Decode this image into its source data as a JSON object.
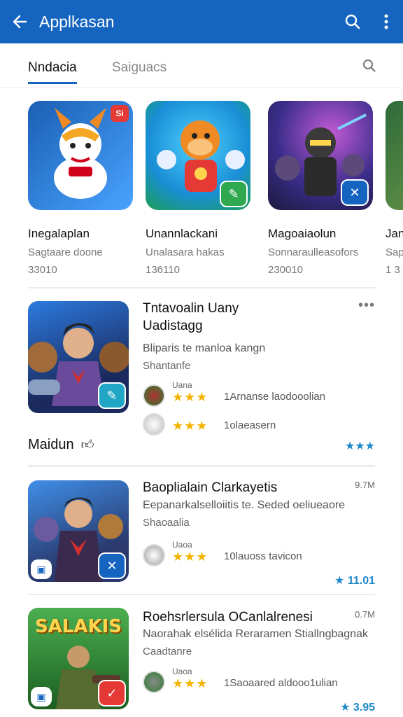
{
  "appbar": {
    "title": "Applkasan"
  },
  "tabs": [
    {
      "label": "Nndacia"
    },
    {
      "label": "Saiguacs"
    }
  ],
  "featured": [
    {
      "name": "Inegalaplan",
      "sub": "Sagtaare doone",
      "count": "33010",
      "badge": "Si",
      "colors": [
        "#1a5fb4",
        "#4aa3ff"
      ]
    },
    {
      "name": "Unannlackani",
      "sub": "Unalasara hakas",
      "count": "136110",
      "colors": [
        "#19a3d6",
        "#1fc87b"
      ]
    },
    {
      "name": "Magoaiaolun",
      "sub": "Sonnaraulleasofors",
      "count": "230010",
      "colors": [
        "#2a2b6d",
        "#c25bd6"
      ]
    },
    {
      "name": "Jan",
      "sub": "Sap",
      "count": "1 3",
      "colors": [
        "#2d6a3a",
        "#7aa04a"
      ]
    }
  ],
  "list": [
    {
      "title_line1": "Tntavoalin Uany",
      "title_line2": "Uadistagg",
      "desc": "Bliparis te manloa kangn",
      "sub": "Shantanfe",
      "reviews": [
        {
          "name": "Uana",
          "stars": "★★★",
          "text": "1Arnanse laodooolian"
        },
        {
          "name": "",
          "stars": "★★★",
          "text": "1olaeasern"
        }
      ],
      "rating": "★★★"
    },
    {
      "title": "Baoplialain Clarkayetis",
      "size": "9.7M",
      "desc": "Eepanarkalselloiitis te. Seded oeliueaore",
      "sub": "Shaoaalia",
      "reviews": [
        {
          "name": "Uaoa",
          "stars": "★★★",
          "text": "10lauoss tavicon"
        }
      ],
      "rating": "★ 11.01"
    },
    {
      "title": "Roehsrlersula OCanlalrenesi",
      "size": "0.7M",
      "desc": "Naorahak elsélida Reraramen Stiallngbagnak",
      "sub": "Caadtanre",
      "reviews": [
        {
          "name": "Uaoa",
          "stars": "★★★",
          "text": "1Saoaared aldooo1ulian"
        }
      ],
      "rating": "★ 3.95",
      "icon_text": "SALAKIS"
    }
  ],
  "section": {
    "label": "Maidun"
  }
}
